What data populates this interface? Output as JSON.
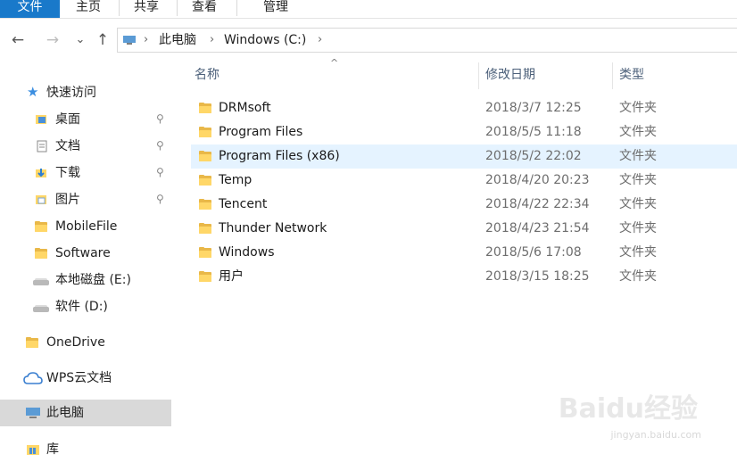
{
  "ribbon": {
    "tabs": [
      "文件",
      "主页",
      "共享",
      "查看",
      "管理"
    ]
  },
  "nav": {
    "back": "←",
    "forward": "→",
    "recent": "⌄",
    "up": "↑",
    "breadcrumb": [
      "此电脑",
      "Windows (C:)"
    ],
    "chevron": "›"
  },
  "sidebar": {
    "quick_access": "快速访问",
    "items": [
      {
        "label": "桌面",
        "pinned": true
      },
      {
        "label": "文档",
        "pinned": true
      },
      {
        "label": "下载",
        "pinned": true
      },
      {
        "label": "图片",
        "pinned": true
      },
      {
        "label": "MobileFile",
        "pinned": false
      },
      {
        "label": "Software",
        "pinned": false
      },
      {
        "label": "本地磁盘 (E:)",
        "pinned": false
      },
      {
        "label": "软件 (D:)",
        "pinned": false
      }
    ],
    "onedrive": "OneDrive",
    "wps": "WPS云文档",
    "this_pc": "此电脑",
    "library": "库",
    "pin_glyph": "📌"
  },
  "columns": {
    "name": "名称",
    "modified": "修改日期",
    "type": "类型",
    "sort_glyph": "^"
  },
  "files": [
    {
      "name": "DRMsoft",
      "date": "2018/3/7 12:25",
      "type": "文件夹"
    },
    {
      "name": "Program Files",
      "date": "2018/5/5 11:18",
      "type": "文件夹"
    },
    {
      "name": "Program Files (x86)",
      "date": "2018/5/2 22:02",
      "type": "文件夹"
    },
    {
      "name": "Temp",
      "date": "2018/4/20 20:23",
      "type": "文件夹"
    },
    {
      "name": "Tencent",
      "date": "2018/4/22 22:34",
      "type": "文件夹"
    },
    {
      "name": "Thunder Network",
      "date": "2018/4/23 21:54",
      "type": "文件夹"
    },
    {
      "name": "Windows",
      "date": "2018/5/6 17:08",
      "type": "文件夹"
    },
    {
      "name": "用户",
      "date": "2018/3/15 18:25",
      "type": "文件夹"
    }
  ],
  "watermark": {
    "brand": "Baidu经验",
    "url": "jingyan.baidu.com"
  },
  "colors": {
    "file_tab": "#1979ca",
    "hover_row": "#e5f3ff",
    "selected_sidebar": "#d9d9d9",
    "folder": "#ffd768"
  }
}
